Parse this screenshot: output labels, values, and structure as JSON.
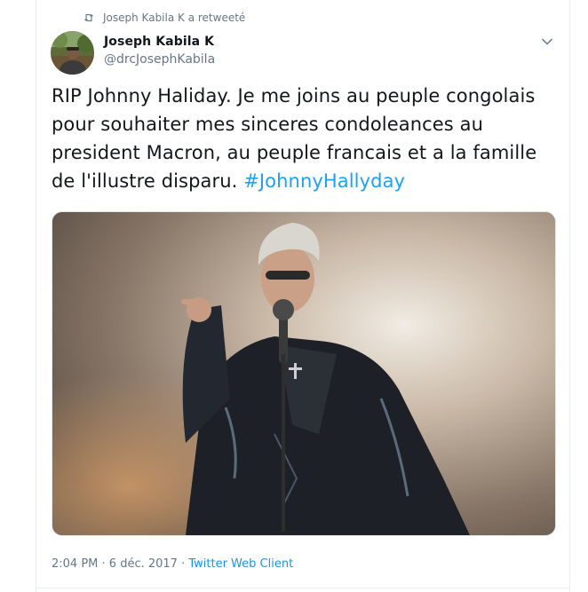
{
  "retweet": {
    "icon": "retweet-icon",
    "text": "Joseph Kabila K a retweeté"
  },
  "author": {
    "display_name": "Joseph Kabila K",
    "handle": "@drcJosephKabila",
    "avatar_icon": "user-avatar"
  },
  "tweet": {
    "text": "RIP Johnny Haliday. Je me joins au peuple congolais pour souhaiter mes sinceres condoleances au president Macron, au peuple francais et a la famille de l'illustre disparu. ",
    "hashtag": "#JohnnyHallyday",
    "media_description": "photo"
  },
  "meta": {
    "time": "2:04 PM",
    "separator1": " · ",
    "date": "6 déc. 2017",
    "separator2": " · ",
    "client": "Twitter Web Client"
  },
  "colors": {
    "link": "#1da1f2",
    "secondary_text": "#657786",
    "primary_text": "#14171a"
  }
}
